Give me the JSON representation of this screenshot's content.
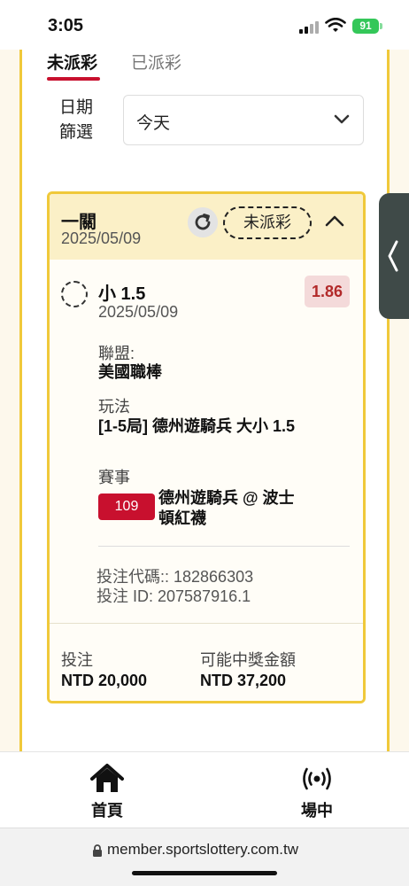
{
  "status_bar": {
    "time": "3:05",
    "battery": "91"
  },
  "tabs": {
    "active": "未派彩",
    "inactive": "已派彩"
  },
  "filter": {
    "label": "日期篩選",
    "value": "今天"
  },
  "bet_card": {
    "type_label": "一關",
    "date": "2025/05/09",
    "status": "未派彩",
    "selection": {
      "name": "小 1.5",
      "date": "2025/05/09",
      "odds": "1.86"
    },
    "league_label": "聯盟:",
    "league_value": "美國職棒",
    "market_label": "玩法",
    "market_value": "[1-5局] 德州遊騎兵 大小 1.5",
    "event_label": "賽事",
    "event_number": "109",
    "event_name": "德州遊騎兵 @ 波士頓紅襪",
    "bet_code_line": "投注代碼:: 182866303",
    "bet_id_line": "投注 ID: 207587916.1",
    "stake_label": "投注",
    "stake_value": "NTD 20,000",
    "payout_label": "可能中獎金額",
    "payout_value": "NTD 37,200"
  },
  "bottom_nav": {
    "home_label": "首頁",
    "live_label": "場中"
  },
  "browser": {
    "url": "member.sportslottery.com.tw"
  },
  "colors": {
    "accent_red": "#c8102e",
    "card_border": "#f0c93a",
    "odds_text": "#b22a2a"
  },
  "icons": [
    "refresh-icon",
    "chevron-up-icon",
    "chevron-down-icon",
    "home-icon",
    "live-signal-icon",
    "lock-icon",
    "chevron-left-icon"
  ]
}
